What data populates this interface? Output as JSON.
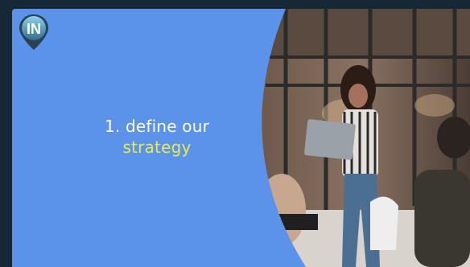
{
  "logo": {
    "text": "IN"
  },
  "slide": {
    "line1": "1. define our",
    "line2": "strategy"
  },
  "colors": {
    "background": "#162735",
    "panel_blue": "#5b93ea",
    "highlight_yellow": "#e9ec4a",
    "text_white": "#ffffff"
  }
}
